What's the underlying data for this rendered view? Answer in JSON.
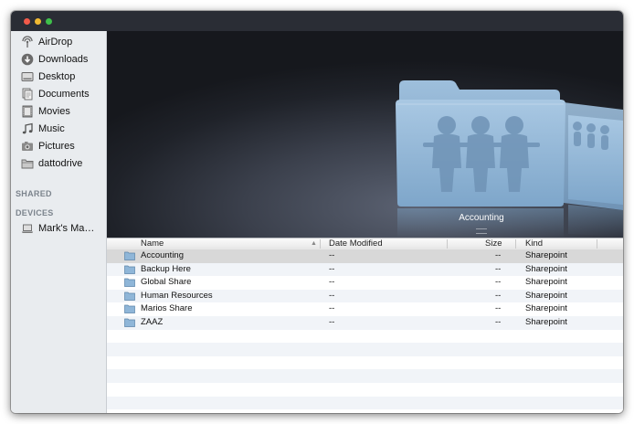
{
  "sidebar": {
    "favorites": [
      {
        "label": "AirDrop",
        "icon": "airdrop-icon"
      },
      {
        "label": "Downloads",
        "icon": "downloads-icon"
      },
      {
        "label": "Desktop",
        "icon": "desktop-icon"
      },
      {
        "label": "Documents",
        "icon": "documents-icon"
      },
      {
        "label": "Movies",
        "icon": "movies-icon"
      },
      {
        "label": "Music",
        "icon": "music-icon"
      },
      {
        "label": "Pictures",
        "icon": "pictures-icon"
      },
      {
        "label": "dattodrive",
        "icon": "folder-icon"
      }
    ],
    "shared_header": "SHARED",
    "devices_header": "DEVICES",
    "devices": [
      {
        "label": "Mark's Ma…",
        "icon": "laptop-icon"
      }
    ]
  },
  "coverflow": {
    "selected_title": "Accounting"
  },
  "columns": {
    "name": "Name",
    "date_modified": "Date Modified",
    "size": "Size",
    "kind": "Kind"
  },
  "files": [
    {
      "name": "Accounting",
      "date": "--",
      "size": "--",
      "kind": "Sharepoint"
    },
    {
      "name": "Backup Here",
      "date": "--",
      "size": "--",
      "kind": "Sharepoint"
    },
    {
      "name": "Global Share",
      "date": "--",
      "size": "--",
      "kind": "Sharepoint"
    },
    {
      "name": "Human Resources",
      "date": "--",
      "size": "--",
      "kind": "Sharepoint"
    },
    {
      "name": "Marios Share",
      "date": "--",
      "size": "--",
      "kind": "Sharepoint"
    },
    {
      "name": "ZAAZ",
      "date": "--",
      "size": "--",
      "kind": "Sharepoint"
    }
  ],
  "colors": {
    "selection": "#d8d8d8",
    "folder_blue": "#8fb6d8"
  }
}
